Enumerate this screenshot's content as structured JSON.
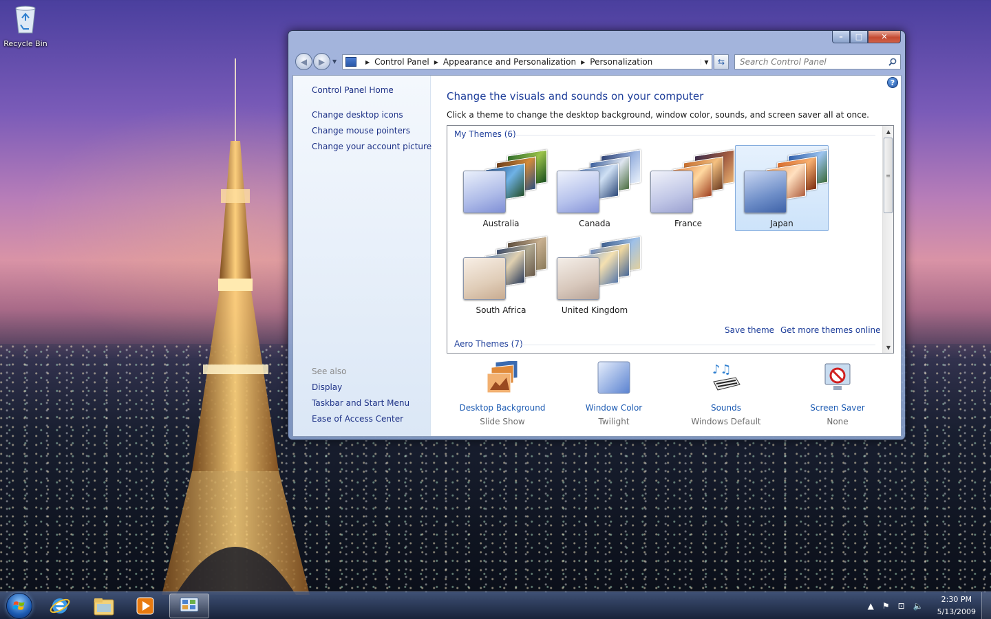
{
  "desktop": {
    "recycle_bin_label": "Recycle Bin"
  },
  "window": {
    "caption_buttons": {
      "minimize": "–",
      "maximize": "□",
      "close": "✕"
    },
    "address_bar": {
      "breadcrumbs": [
        "Control Panel",
        "Appearance and Personalization",
        "Personalization"
      ]
    },
    "search": {
      "placeholder": "Search Control Panel"
    },
    "sidebar": {
      "home_link": "Control Panel Home",
      "links": [
        "Change desktop icons",
        "Change mouse pointers",
        "Change your account picture"
      ],
      "see_also_label": "See also",
      "see_also_links": [
        "Display",
        "Taskbar and Start Menu",
        "Ease of Access Center"
      ]
    },
    "main": {
      "title": "Change the visuals and sounds on your computer",
      "subtitle": "Click a theme to change the desktop background, window color, sounds, and screen saver all at once.",
      "my_themes_label": "My Themes (6)",
      "aero_themes_label": "Aero Themes (7)",
      "themes": [
        {
          "name": "Australia",
          "selected": false
        },
        {
          "name": "Canada",
          "selected": false
        },
        {
          "name": "France",
          "selected": false
        },
        {
          "name": "Japan",
          "selected": true
        },
        {
          "name": "South Africa",
          "selected": false
        },
        {
          "name": "United Kingdom",
          "selected": false
        }
      ],
      "save_theme": "Save theme",
      "get_more_themes": "Get more themes online",
      "bottom_items": [
        {
          "label": "Desktop Background",
          "value": "Slide Show",
          "icon": "desktop-background-icon"
        },
        {
          "label": "Window Color",
          "value": "Twilight",
          "icon": "window-color-icon"
        },
        {
          "label": "Sounds",
          "value": "Windows Default",
          "icon": "sounds-icon"
        },
        {
          "label": "Screen Saver",
          "value": "None",
          "icon": "screen-saver-icon"
        }
      ]
    }
  },
  "taskbar": {
    "pinned": [
      "internet-explorer-icon",
      "windows-explorer-icon",
      "media-player-icon",
      "control-panel-icon"
    ],
    "tray_icons": [
      "show-hidden-icons-icon",
      "action-center-flag-icon",
      "network-icon",
      "volume-icon"
    ],
    "clock_time": "2:30 PM",
    "clock_date": "5/13/2009"
  },
  "colors": {
    "link_blue": "#1e3287",
    "title_blue": "#1e3e9a",
    "selection_bg": "#cde3fa",
    "selection_border": "#84acdd"
  }
}
